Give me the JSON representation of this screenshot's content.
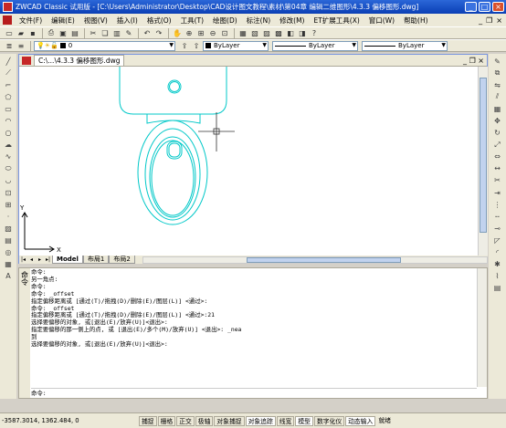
{
  "window": {
    "title": "ZWCAD Classic 试用版 - [C:\\Users\\Administrator\\Desktop\\CAD设计图文教程\\素材\\第04章 编辑二维图形\\4.3.3 偏移图形.dwg]"
  },
  "menu": [
    "文件(F)",
    "编辑(E)",
    "视图(V)",
    "插入(I)",
    "格式(O)",
    "工具(T)",
    "绘图(D)",
    "标注(N)",
    "修改(M)",
    "ET扩展工具(X)",
    "窗口(W)",
    "帮助(H)"
  ],
  "layer_combo": {
    "value": "0"
  },
  "properties": {
    "color": "ByLayer",
    "linetype": "ByLayer",
    "lineweight": "ByLayer"
  },
  "document": {
    "tab_title": "C:\\...\\4.3.3 偏移图形.dwg",
    "layout_tabs": [
      "Model",
      "布局1",
      "布局2"
    ],
    "active_tab": "Model",
    "ucs": {
      "x_label": "X",
      "y_label": "Y"
    },
    "drawing_color": "#00c8c8"
  },
  "command": {
    "side_label": "命令",
    "history": [
      "命令:",
      "另一角点:",
      "命令:",
      "命令: _offset",
      "指定偏移距离或 [通过(T)/拖拽(D)/删除(E)/图层(L)] <通过>:",
      "命令: _offset",
      "指定偏移距离或 [通过(T)/拖拽(D)/删除(E)/图层(L)] <通过>:21",
      "选择要偏移的对象, 或[退出(E)/放弃(U)]<退出>:",
      "指定要偏移的那一侧上的点, 或 [退出(E)/多个(M)/放弃(U)] <退出>: _nea",
      "到",
      "选择要偏移的对象, 或[退出(E)/放弃(U)]<退出>:"
    ],
    "prompt": "命令:"
  },
  "status": {
    "coords": "-3587.3014, 1362.484, 0",
    "buttons": [
      "捕捉",
      "栅格",
      "正交",
      "极轴",
      "对象捕捉",
      "对象追踪",
      "线宽",
      "模型",
      "数字化仪",
      "动态输入",
      "就绪"
    ]
  }
}
